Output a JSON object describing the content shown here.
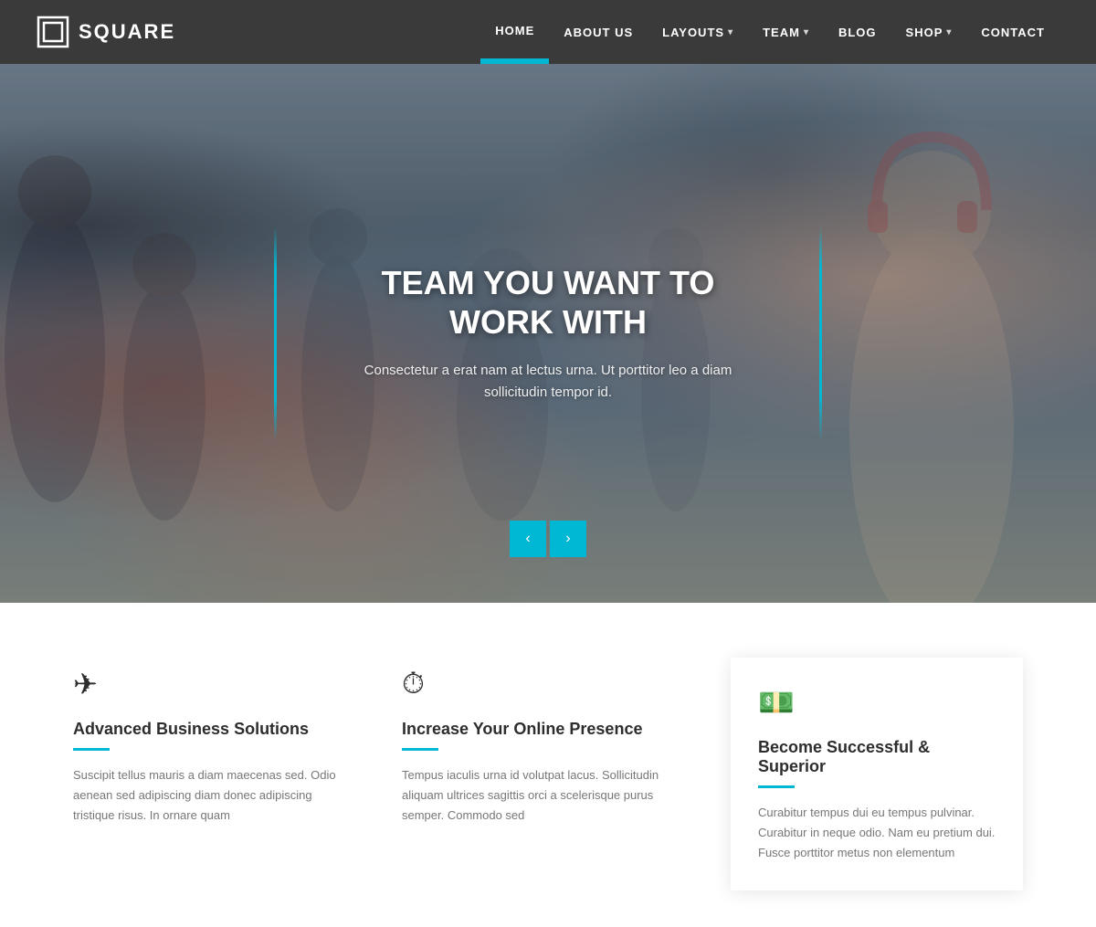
{
  "brand": {
    "logo_text": "SQUARE",
    "logo_icon_alt": "square-logo-icon"
  },
  "nav": {
    "items": [
      {
        "label": "HOME",
        "active": true,
        "has_dropdown": false
      },
      {
        "label": "ABOUT US",
        "active": false,
        "has_dropdown": false
      },
      {
        "label": "LAYOUTS",
        "active": false,
        "has_dropdown": true
      },
      {
        "label": "TEAM",
        "active": false,
        "has_dropdown": true
      },
      {
        "label": "BLOG",
        "active": false,
        "has_dropdown": false
      },
      {
        "label": "SHOP",
        "active": false,
        "has_dropdown": true
      },
      {
        "label": "CONTACT",
        "active": false,
        "has_dropdown": false
      }
    ]
  },
  "hero": {
    "title": "TEAM YOU WANT TO WORK WITH",
    "subtitle": "Consectetur a erat nam at lectus urna. Ut porttitor leo a diam sollicitudin tempor id.",
    "prev_btn": "‹",
    "next_btn": "›"
  },
  "features": {
    "items": [
      {
        "icon": "✈",
        "title": "Advanced Business Solutions",
        "text": "Suscipit tellus mauris a diam maecenas sed. Odio aenean sed adipiscing diam donec adipiscing tristique risus. In ornare quam"
      },
      {
        "icon": "⏱",
        "title": "Increase Your Online Presence",
        "text": "Tempus iaculis urna id volutpat lacus. Sollicitudin aliquam ultrices sagittis orci a scelerisque purus semper. Commodo sed"
      },
      {
        "icon": "💵",
        "title": "Become Successful & Superior",
        "text": "Curabitur tempus dui eu tempus pulvinar. Curabitur in neque odio. Nam eu pretium dui. Fusce porttitor metus non elementum"
      }
    ]
  },
  "colors": {
    "accent": "#00b8d4",
    "navbar_bg": "#3a3a3a",
    "text_dark": "#2d2d2d",
    "text_muted": "#777777"
  }
}
